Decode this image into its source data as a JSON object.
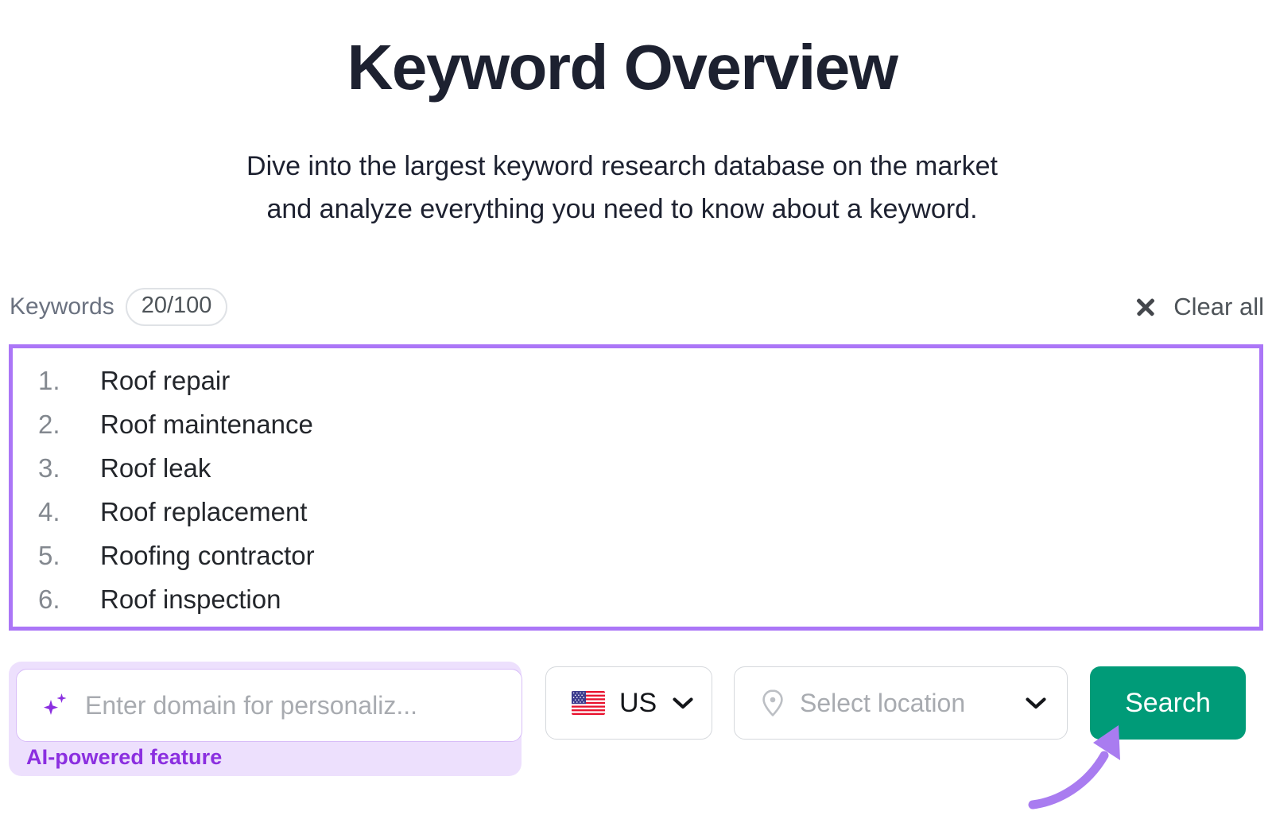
{
  "header": {
    "title": "Keyword Overview",
    "subtitle_line1": "Dive into the largest keyword research database on the market",
    "subtitle_line2": "and analyze everything you need to know about a keyword."
  },
  "keywords_panel": {
    "label": "Keywords",
    "counter": "20/100",
    "counter_used": 20,
    "counter_limit": 100,
    "clear_all_label": "Clear all",
    "clear_icon": "close-x-icon",
    "border_color": "#ab76f7",
    "visible_items": [
      {
        "number": "1.",
        "text": "Roof repair"
      },
      {
        "number": "2.",
        "text": "Roof maintenance"
      },
      {
        "number": "3.",
        "text": "Roof leak"
      },
      {
        "number": "4.",
        "text": "Roof replacement"
      },
      {
        "number": "5.",
        "text": "Roofing contractor"
      },
      {
        "number": "6.",
        "text": "Roof inspection"
      }
    ]
  },
  "controls": {
    "domain_input": {
      "placeholder": "Enter domain for personaliz...",
      "value": "",
      "icon": "ai-sparkle-icon",
      "note": "AI-powered feature",
      "note_color": "#8b2fe0",
      "badge_bg": "#ede0fd"
    },
    "country_select": {
      "value": "US",
      "flag": "us-flag-icon",
      "chevron": "chevron-down-icon"
    },
    "location_select": {
      "placeholder": "Select location",
      "value": "",
      "icon": "location-pin-icon",
      "chevron": "chevron-down-icon"
    },
    "search_button": {
      "label": "Search",
      "color": "#009b78"
    }
  },
  "annotation": {
    "arrow_target": "search-button",
    "arrow_color": "#a97cf0"
  }
}
